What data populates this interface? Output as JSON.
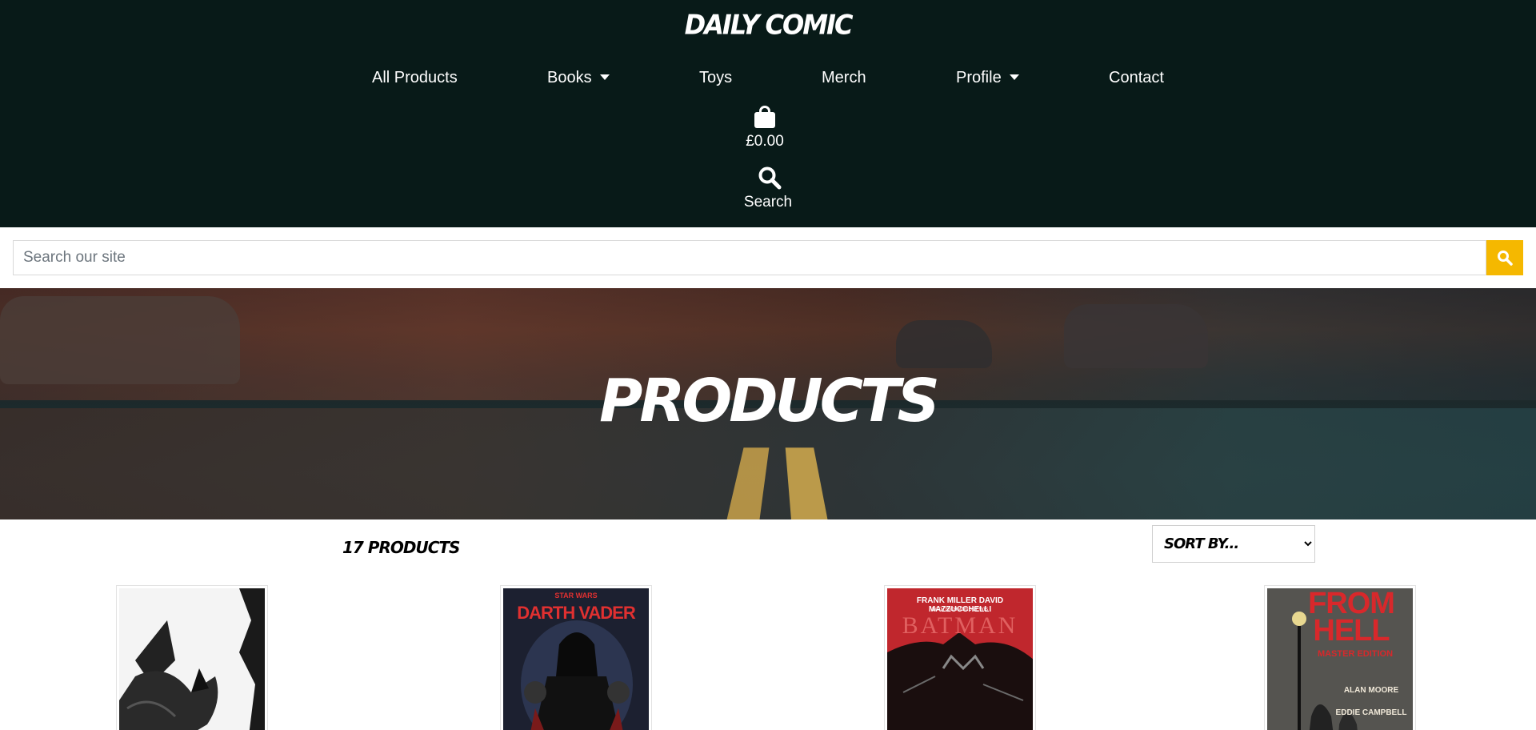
{
  "header": {
    "brand": "DAILY COMIC",
    "nav": [
      {
        "label": "All Products",
        "dropdown": false
      },
      {
        "label": "Books",
        "dropdown": true
      },
      {
        "label": "Toys",
        "dropdown": false
      },
      {
        "label": "Merch",
        "dropdown": false
      },
      {
        "label": "Profile",
        "dropdown": true
      },
      {
        "label": "Contact",
        "dropdown": false
      }
    ],
    "bag_total": "£0.00",
    "search_label": "Search"
  },
  "search": {
    "placeholder": "Search our site",
    "value": "",
    "button_color": "#f5b800"
  },
  "hero": {
    "title": "PRODUCTS"
  },
  "products": {
    "count_label": "17 PRODUCTS",
    "sort": {
      "selected": "SORT BY...",
      "options": [
        "SORT BY..."
      ]
    },
    "items": [
      {
        "cover_text_top": "",
        "cover_text_main": ""
      },
      {
        "cover_text_top": "STAR WARS",
        "cover_text_main": "DARTH VADER"
      },
      {
        "cover_text_top": "FRANK MILLER  DAVID MAZZUCCHELLI",
        "cover_text_sub": "WITH RICHMOND LEWIS",
        "cover_text_main": "BATMAN"
      },
      {
        "cover_text_top": "FROM HELL",
        "cover_text_sub": "MASTER EDITION",
        "cover_text_main": "ALAN MOORE",
        "cover_text_extra": "EDDIE CAMPBELL"
      }
    ]
  },
  "colors": {
    "header_bg": "#081a18",
    "accent": "#f5b800"
  }
}
